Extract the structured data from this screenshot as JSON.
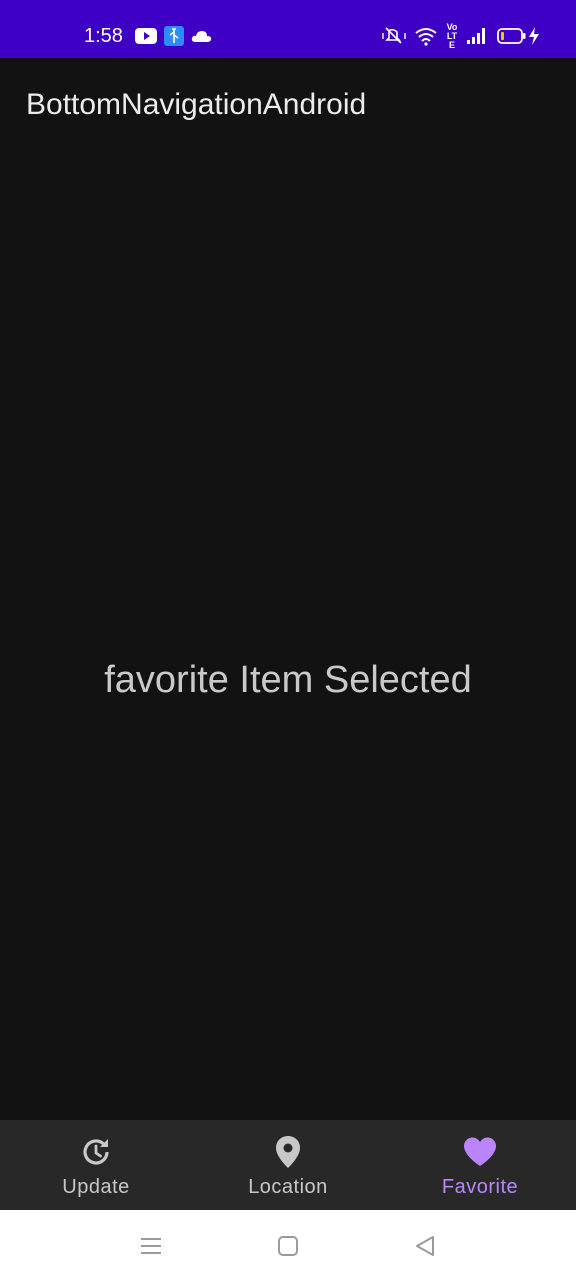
{
  "status_bar": {
    "time": "1:58",
    "left_icons": [
      "youtube-icon",
      "usb-debug-icon",
      "cloud-icon"
    ],
    "right_icons": [
      "mute-icon",
      "wifi-icon",
      "volte-icon",
      "signal-icon",
      "battery-icon",
      "charging-icon"
    ],
    "volte_text": "Vo LTE",
    "background_color": "#3f00c6"
  },
  "app_bar": {
    "title": "BottomNavigationAndroid"
  },
  "content": {
    "message": "favorite Item Selected"
  },
  "bottom_nav": {
    "items": [
      {
        "label": "Update",
        "icon": "update-clock-icon",
        "selected": false
      },
      {
        "label": "Location",
        "icon": "location-pin-icon",
        "selected": false
      },
      {
        "label": "Favorite",
        "icon": "heart-icon",
        "selected": true
      }
    ],
    "selected_color": "#bb86fc",
    "unselected_color": "#c8c8c8"
  },
  "system_nav": {
    "buttons": [
      "menu-icon",
      "home-icon",
      "back-icon"
    ]
  }
}
